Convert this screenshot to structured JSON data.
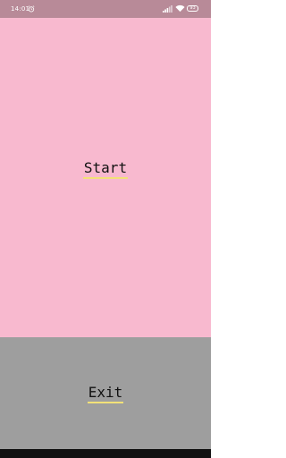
{
  "status_bar": {
    "time": "14:01",
    "battery": "93",
    "icons": [
      "alarm-icon",
      "signal-icon",
      "wifi-icon",
      "battery-icon"
    ]
  },
  "main": {
    "start_label": "Start",
    "exit_label": "Exit"
  },
  "colors": {
    "start_bg": "#f8b9cf",
    "exit_bg": "#9e9e9e",
    "status_bg": "#b88a98",
    "underline": "#f2e178"
  }
}
